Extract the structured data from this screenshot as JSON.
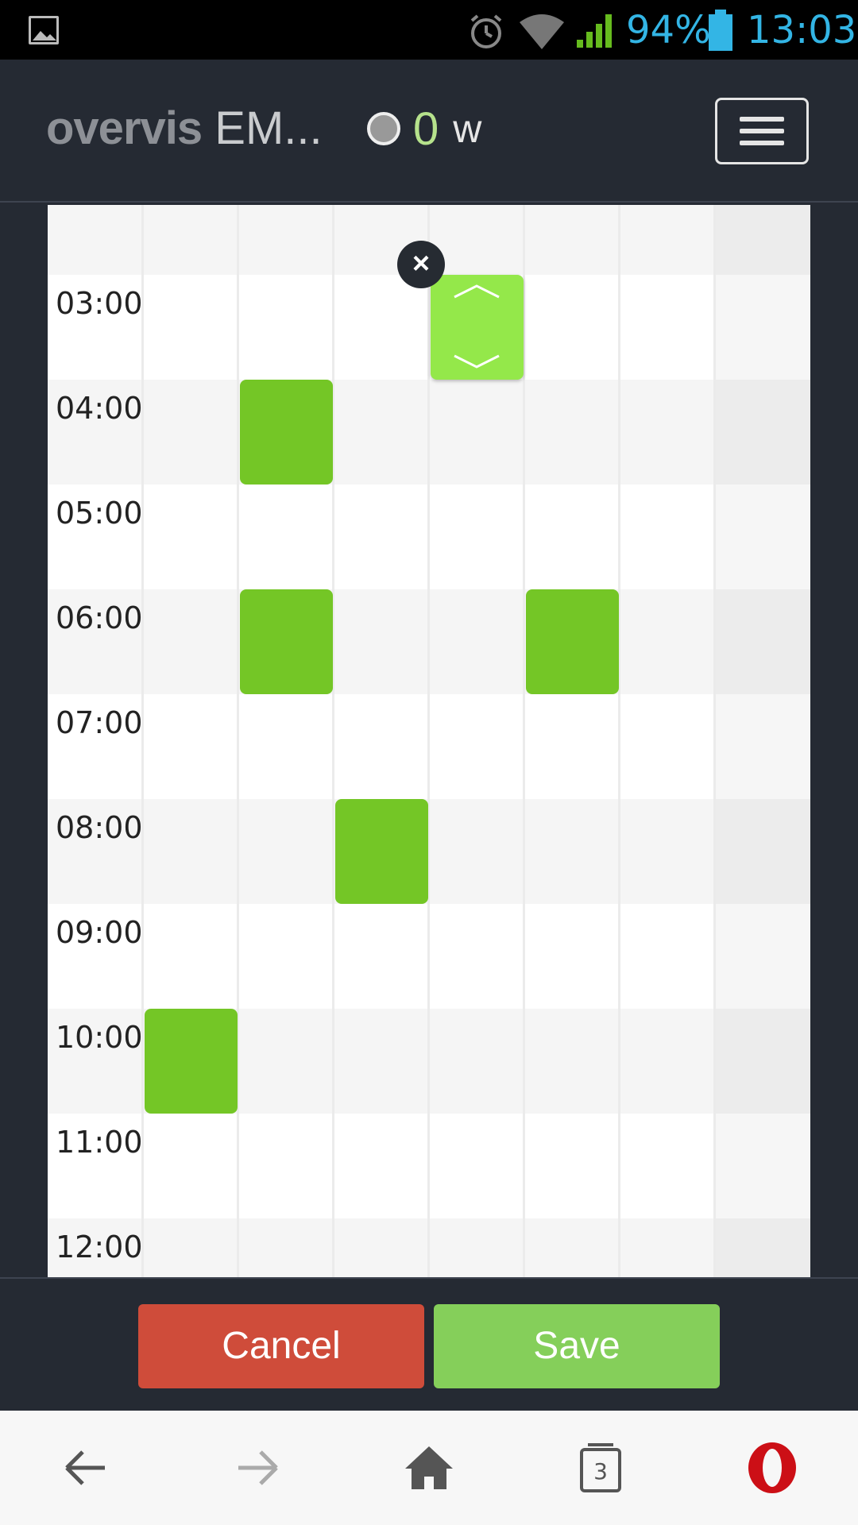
{
  "status_bar": {
    "battery_percent": "94%",
    "time": "13:03",
    "icons": [
      "gallery-icon",
      "alarm-icon",
      "wifi-icon",
      "signal-icon",
      "battery-icon"
    ]
  },
  "header": {
    "brand_part1": "overvis",
    "brand_part2": "EM...",
    "power_value": "0",
    "power_unit": "w",
    "menu_icon": "hamburger-menu-icon"
  },
  "schedule": {
    "times": [
      "03:00",
      "04:00",
      "05:00",
      "06:00",
      "07:00",
      "08:00",
      "09:00",
      "10:00",
      "11:00",
      "12:00"
    ],
    "blocks": [
      {
        "day_index": 4,
        "hour": "03:00",
        "active": true
      },
      {
        "day_index": 2,
        "hour": "04:00",
        "active": false
      },
      {
        "day_index": 2,
        "hour": "06:00",
        "active": false
      },
      {
        "day_index": 5,
        "hour": "06:00",
        "active": false
      },
      {
        "day_index": 3,
        "hour": "08:00",
        "active": false
      },
      {
        "day_index": 1,
        "hour": "10:00",
        "active": false
      }
    ],
    "close_symbol": "×"
  },
  "actions": {
    "cancel_label": "Cancel",
    "save_label": "Save"
  },
  "colors": {
    "block": "#74c626",
    "block_active": "#94e84a",
    "cancel": "#cf4c3a",
    "save": "#85cf5a",
    "accent_status": "#33b5e5"
  },
  "browser_bar": {
    "tab_count": "3",
    "icons": [
      "back-arrow-icon",
      "forward-arrow-icon",
      "home-icon",
      "tabs-icon",
      "opera-logo-icon"
    ]
  }
}
